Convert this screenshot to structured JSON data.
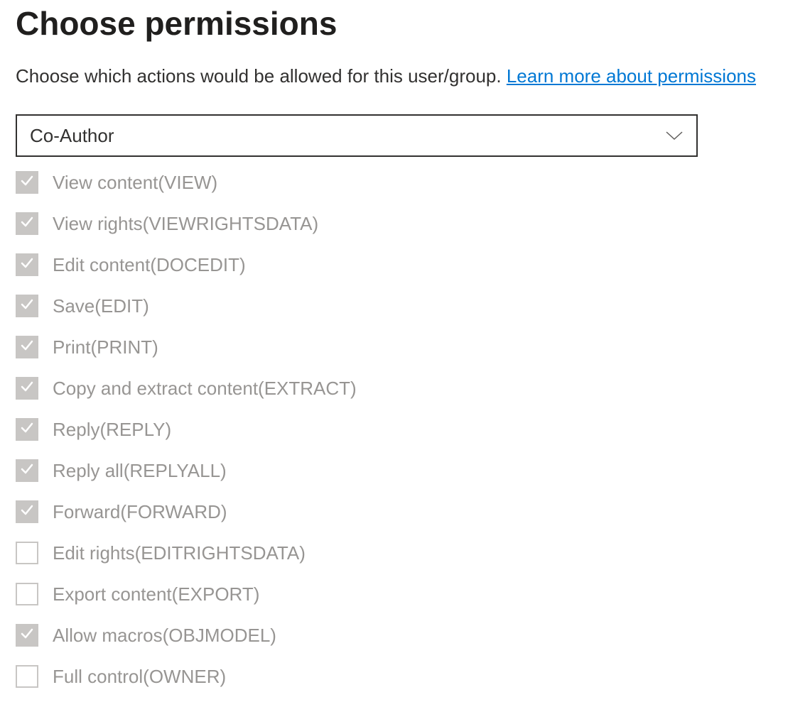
{
  "header": {
    "title": "Choose permissions",
    "description_prefix": "Choose which actions would be allowed for this user/group. ",
    "link_text": "Learn more about permissions"
  },
  "dropdown": {
    "selected": "Co-Author"
  },
  "permissions": [
    {
      "label": "View content(VIEW)",
      "checked": true
    },
    {
      "label": "View rights(VIEWRIGHTSDATA)",
      "checked": true
    },
    {
      "label": "Edit content(DOCEDIT)",
      "checked": true
    },
    {
      "label": "Save(EDIT)",
      "checked": true
    },
    {
      "label": "Print(PRINT)",
      "checked": true
    },
    {
      "label": "Copy and extract content(EXTRACT)",
      "checked": true
    },
    {
      "label": "Reply(REPLY)",
      "checked": true
    },
    {
      "label": "Reply all(REPLYALL)",
      "checked": true
    },
    {
      "label": "Forward(FORWARD)",
      "checked": true
    },
    {
      "label": "Edit rights(EDITRIGHTSDATA)",
      "checked": false
    },
    {
      "label": "Export content(EXPORT)",
      "checked": false
    },
    {
      "label": "Allow macros(OBJMODEL)",
      "checked": true
    },
    {
      "label": "Full control(OWNER)",
      "checked": false
    }
  ]
}
